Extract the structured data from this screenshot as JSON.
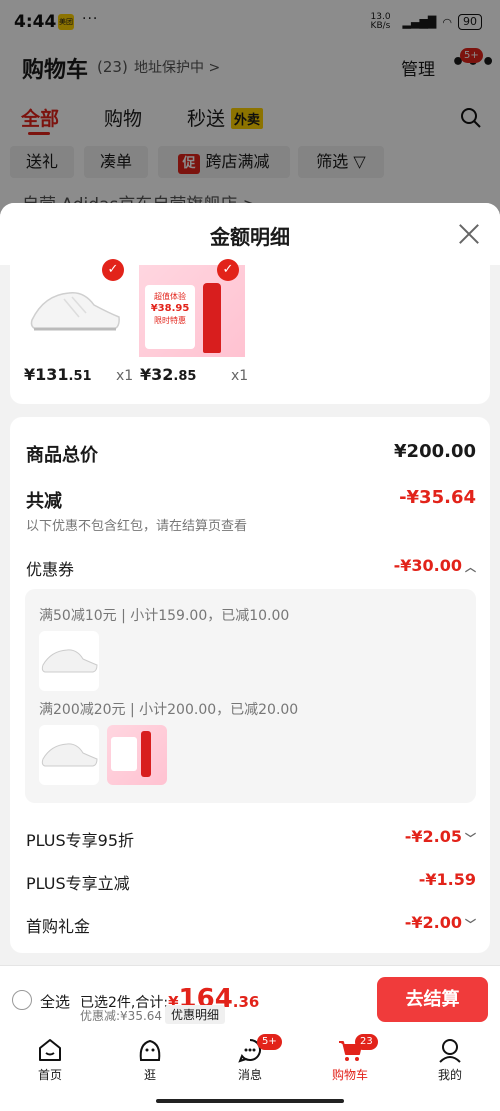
{
  "status_bar": {
    "time": "4:44",
    "app_badge": "美团",
    "dots": "···",
    "network": "13.0 KB/s",
    "signal": "HD",
    "battery": "90"
  },
  "header": {
    "title": "购物车",
    "count": "(23)",
    "address": "地址保护中 >",
    "manage": "管理",
    "more_badge": "5+"
  },
  "tabs": [
    {
      "label": "全部"
    },
    {
      "label": "购物"
    },
    {
      "label": "秒送"
    }
  ],
  "tab_badge": "外卖",
  "chips": [
    {
      "label": "送礼"
    },
    {
      "label": "凑单"
    },
    {
      "label": "跨店满减",
      "promo": "促"
    },
    {
      "label": "筛选"
    }
  ],
  "store_row": "自营 Adidas京东自营旗舰店 >",
  "sheet": {
    "title": "金额明细",
    "products": [
      {
        "price_int": "¥131",
        "price_dec": ".51",
        "qty": "x1"
      },
      {
        "price_int": "¥32",
        "price_dec": ".85",
        "qty": "x1"
      }
    ],
    "bottle_text": [
      "超值体验",
      "¥38.95",
      "限时特惠"
    ],
    "summary": {
      "total_label": "商品总价",
      "total_value": "¥200.00",
      "reduce_label": "共减",
      "reduce_value": "-¥35.64",
      "reduce_note": "以下优惠不包含红包，请在结算页查看",
      "coupon_label": "优惠券",
      "coupon_value": "-¥30.00",
      "coupon_lines": [
        "满50减10元 | 小计159.00，已减10.00",
        "满200减20元 | 小计200.00，已减20.00"
      ],
      "plus1_label": "PLUS专享95折",
      "plus1_value": "-¥2.05",
      "plus2_label": "PLUS专享立减",
      "plus2_value": "-¥1.59",
      "first_label": "首购礼金",
      "first_value": "-¥2.00"
    }
  },
  "bottom": {
    "select_all": "全选",
    "selected": "已选2件,合计:",
    "currency": "¥",
    "total_int": "164",
    "total_dec": ".36",
    "discount": "优惠减:¥35.64",
    "detail": "优惠明细",
    "checkout": "去结算"
  },
  "nav": [
    {
      "label": "首页",
      "icon": "home-icon"
    },
    {
      "label": "逛",
      "icon": "browse-icon"
    },
    {
      "label": "消息",
      "icon": "message-icon",
      "badge": "5+"
    },
    {
      "label": "购物车",
      "icon": "cart-icon",
      "badge": "23"
    },
    {
      "label": "我的",
      "icon": "profile-icon"
    }
  ],
  "colors": {
    "accent": "#e2231a",
    "checkout": "#f03b3b"
  }
}
